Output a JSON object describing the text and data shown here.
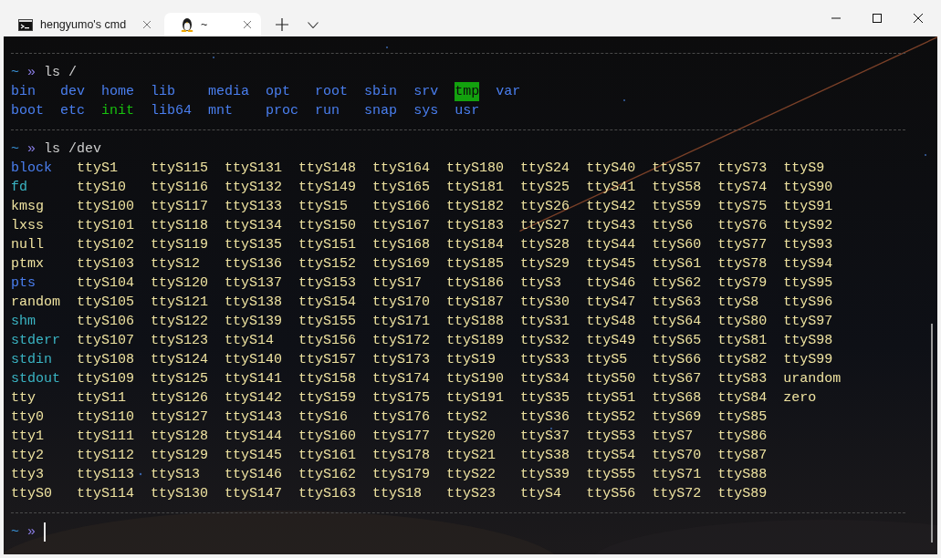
{
  "tabs": [
    {
      "title": "hengyumo's cmd",
      "kind": "cmd",
      "selected": false
    },
    {
      "title": "~",
      "kind": "linux",
      "selected": true
    }
  ],
  "terminal": {
    "sections": [
      {
        "prompt": {
          "path": "~",
          "symbol": "»",
          "command": "ls /"
        },
        "kind": "dir",
        "columns": [
          [
            "bin",
            "boot"
          ],
          [
            "dev",
            "etc"
          ],
          [
            "home",
            {
              "name": "init",
              "kind": "exec"
            }
          ],
          [
            "lib",
            "lib64"
          ],
          [
            "media",
            "mnt"
          ],
          [
            "opt",
            "proc"
          ],
          [
            "root",
            "run"
          ],
          [
            "sbin",
            "snap"
          ],
          [
            "srv",
            "sys"
          ],
          [
            {
              "name": "tmp",
              "kind": "sticky"
            },
            "usr"
          ],
          [
            "var"
          ]
        ]
      },
      {
        "prompt": {
          "path": "~",
          "symbol": "»",
          "command": "ls /dev"
        },
        "kind": "device",
        "columns": [
          [
            {
              "name": "block",
              "kind": "dir"
            },
            {
              "name": "fd",
              "kind": "link"
            },
            "kmsg",
            "lxss",
            "null",
            "ptmx",
            {
              "name": "pts",
              "kind": "dir"
            },
            "random",
            {
              "name": "shm",
              "kind": "link"
            },
            {
              "name": "stderr",
              "kind": "link"
            },
            {
              "name": "stdin",
              "kind": "link"
            },
            {
              "name": "stdout",
              "kind": "link"
            },
            "tty",
            "tty0",
            "tty1",
            "tty2",
            "tty3",
            "ttyS0"
          ],
          [
            "ttyS1",
            "ttyS10",
            "ttyS100",
            "ttyS101",
            "ttyS102",
            "ttyS103",
            "ttyS104",
            "ttyS105",
            "ttyS106",
            "ttyS107",
            "ttyS108",
            "ttyS109",
            "ttyS11",
            "ttyS110",
            "ttyS111",
            "ttyS112",
            "ttyS113",
            "ttyS114"
          ],
          [
            "ttyS115",
            "ttyS116",
            "ttyS117",
            "ttyS118",
            "ttyS119",
            "ttyS12",
            "ttyS120",
            "ttyS121",
            "ttyS122",
            "ttyS123",
            "ttyS124",
            "ttyS125",
            "ttyS126",
            "ttyS127",
            "ttyS128",
            "ttyS129",
            "ttyS13",
            "ttyS130"
          ],
          [
            "ttyS131",
            "ttyS132",
            "ttyS133",
            "ttyS134",
            "ttyS135",
            "ttyS136",
            "ttyS137",
            "ttyS138",
            "ttyS139",
            "ttyS14",
            "ttyS140",
            "ttyS141",
            "ttyS142",
            "ttyS143",
            "ttyS144",
            "ttyS145",
            "ttyS146",
            "ttyS147"
          ],
          [
            "ttyS148",
            "ttyS149",
            "ttyS15",
            "ttyS150",
            "ttyS151",
            "ttyS152",
            "ttyS153",
            "ttyS154",
            "ttyS155",
            "ttyS156",
            "ttyS157",
            "ttyS158",
            "ttyS159",
            "ttyS16",
            "ttyS160",
            "ttyS161",
            "ttyS162",
            "ttyS163"
          ],
          [
            "ttyS164",
            "ttyS165",
            "ttyS166",
            "ttyS167",
            "ttyS168",
            "ttyS169",
            "ttyS17",
            "ttyS170",
            "ttyS171",
            "ttyS172",
            "ttyS173",
            "ttyS174",
            "ttyS175",
            "ttyS176",
            "ttyS177",
            "ttyS178",
            "ttyS179",
            "ttyS18"
          ],
          [
            "ttyS180",
            "ttyS181",
            "ttyS182",
            "ttyS183",
            "ttyS184",
            "ttyS185",
            "ttyS186",
            "ttyS187",
            "ttyS188",
            "ttyS189",
            "ttyS19",
            "ttyS190",
            "ttyS191",
            "ttyS2",
            "ttyS20",
            "ttyS21",
            "ttyS22",
            "ttyS23"
          ],
          [
            "ttyS24",
            "ttyS25",
            "ttyS26",
            "ttyS27",
            "ttyS28",
            "ttyS29",
            "ttyS3",
            "ttyS30",
            "ttyS31",
            "ttyS32",
            "ttyS33",
            "ttyS34",
            "ttyS35",
            "ttyS36",
            "ttyS37",
            "ttyS38",
            "ttyS39",
            "ttyS4"
          ],
          [
            "ttyS40",
            "ttyS41",
            "ttyS42",
            "ttyS43",
            "ttyS44",
            "ttyS45",
            "ttyS46",
            "ttyS47",
            "ttyS48",
            "ttyS49",
            "ttyS5",
            "ttyS50",
            "ttyS51",
            "ttyS52",
            "ttyS53",
            "ttyS54",
            "ttyS55",
            "ttyS56"
          ],
          [
            "ttyS57",
            "ttyS58",
            "ttyS59",
            "ttyS6",
            "ttyS60",
            "ttyS61",
            "ttyS62",
            "ttyS63",
            "ttyS64",
            "ttyS65",
            "ttyS66",
            "ttyS67",
            "ttyS68",
            "ttyS69",
            "ttyS7",
            "ttyS70",
            "ttyS71",
            "ttyS72"
          ],
          [
            "ttyS73",
            "ttyS74",
            "ttyS75",
            "ttyS76",
            "ttyS77",
            "ttyS78",
            "ttyS79",
            "ttyS8",
            "ttyS80",
            "ttyS81",
            "ttyS82",
            "ttyS83",
            "ttyS84",
            "ttyS85",
            "ttyS86",
            "ttyS87",
            "ttyS88",
            "ttyS89"
          ],
          [
            "ttyS9",
            "ttyS90",
            "ttyS91",
            "ttyS92",
            "ttyS93",
            "ttyS94",
            "ttyS95",
            "ttyS96",
            "ttyS97",
            "ttyS98",
            "ttyS99",
            "urandom",
            "zero"
          ]
        ]
      }
    ],
    "input": {
      "path": "~",
      "symbol": "»"
    }
  }
}
